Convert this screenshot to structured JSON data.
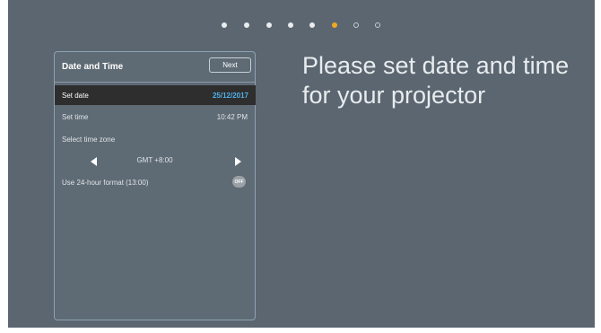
{
  "progress": {
    "steps": [
      "done",
      "done",
      "done",
      "done",
      "done",
      "current",
      "todo",
      "todo"
    ],
    "colors": {
      "done": "#e9edf0",
      "current": "#f0a823",
      "todo": "#c7cdd2"
    }
  },
  "panel": {
    "title": "Date and Time",
    "next_label": "Next",
    "set_date": {
      "label": "Set date",
      "value": "25/12/2017"
    },
    "set_time": {
      "label": "Set time",
      "value": "10:42 PM"
    },
    "time_zone": {
      "label": "Select time zone",
      "value": "GMT +8:00"
    },
    "format_24h": {
      "label": "Use 24-hour format (13:00)",
      "toggle_label": "OFF",
      "state": "off"
    }
  },
  "heading": "Please set date and time for your projector",
  "colors": {
    "background": "#5b6670",
    "selected_row": "#2f2e2f",
    "accent_value": "#4fb2e8"
  }
}
